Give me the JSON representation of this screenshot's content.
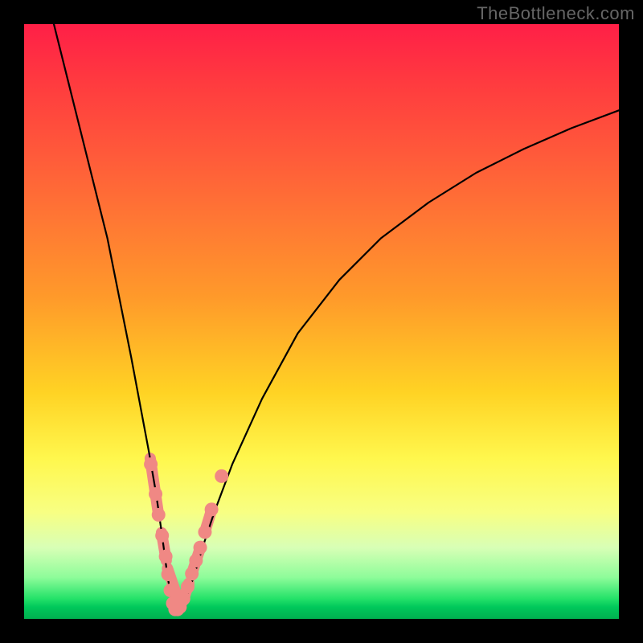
{
  "watermark": "TheBottleneck.com",
  "chart_data": {
    "type": "line",
    "title": "",
    "xlabel": "",
    "ylabel": "",
    "xlim": [
      0,
      100
    ],
    "ylim": [
      0,
      100
    ],
    "grid": false,
    "legend": false,
    "series": [
      {
        "name": "bottleneck-curve",
        "x": [
          5,
          8,
          11,
          14,
          16,
          18,
          19.5,
          21,
          22.2,
          23.2,
          24,
          24.7,
          25.3,
          26,
          27,
          28.5,
          30,
          32,
          35,
          40,
          46,
          53,
          60,
          68,
          76,
          84,
          92,
          100
        ],
        "y": [
          100,
          88,
          76,
          64,
          54,
          44,
          36,
          28,
          21,
          14,
          8,
          3.5,
          1.5,
          1.5,
          3,
          7,
          12,
          18,
          26,
          37,
          48,
          57,
          64,
          70,
          75,
          79,
          82.5,
          85.5
        ]
      }
    ],
    "markers": {
      "name": "highlighted-points",
      "color": "#f08884",
      "x": [
        21.3,
        22.1,
        22.6,
        23.2,
        23.8,
        24.2,
        24.6,
        25.0,
        25.4,
        25.8,
        26.2,
        26.8,
        27.5,
        28.2,
        28.9,
        29.6,
        30.4,
        31.5,
        33.2
      ],
      "y": [
        26.0,
        21.0,
        17.5,
        14.0,
        10.5,
        7.5,
        4.8,
        2.6,
        1.6,
        1.6,
        2.0,
        3.4,
        5.4,
        7.6,
        9.8,
        12.0,
        14.6,
        18.4,
        24.0
      ]
    },
    "marker_segments": [
      {
        "x1": 21.2,
        "y1": 27.0,
        "x2": 22.6,
        "y2": 17.5
      },
      {
        "x1": 23.1,
        "y1": 14.5,
        "x2": 23.9,
        "y2": 9.8
      },
      {
        "x1": 24.1,
        "y1": 8.5,
        "x2": 26.3,
        "y2": 2.0
      },
      {
        "x1": 26.7,
        "y1": 3.0,
        "x2": 27.7,
        "y2": 6.0
      },
      {
        "x1": 28.1,
        "y1": 7.3,
        "x2": 29.7,
        "y2": 12.2
      },
      {
        "x1": 30.5,
        "y1": 15.0,
        "x2": 31.6,
        "y2": 18.6
      }
    ]
  }
}
